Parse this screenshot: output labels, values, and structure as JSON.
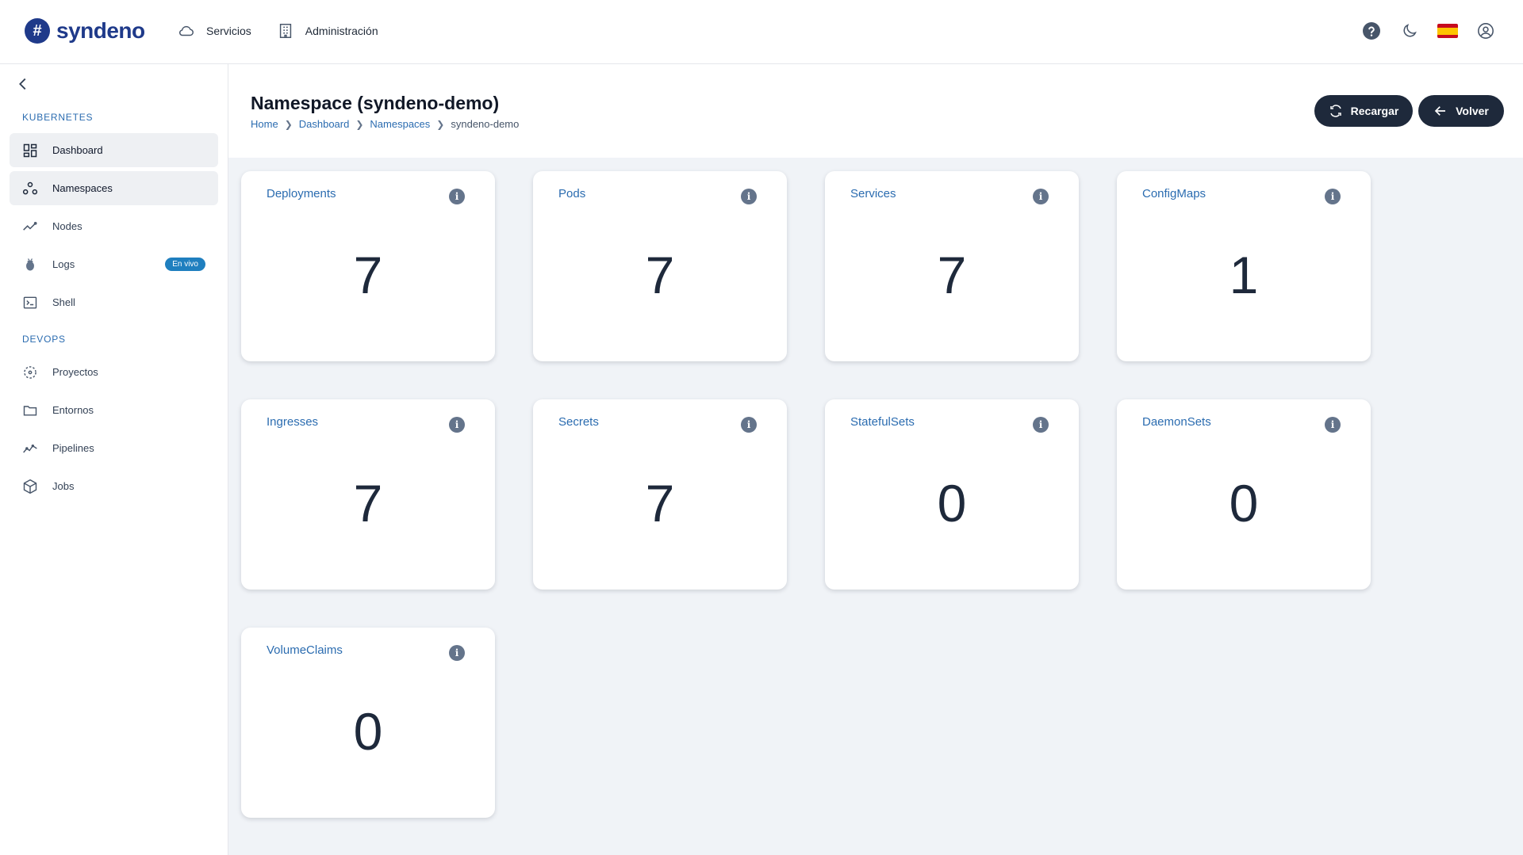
{
  "app": {
    "logo_text": "syndeno",
    "logo_glyph": "#"
  },
  "topnav": {
    "items": [
      {
        "label": "Servicios",
        "icon": "cloud-icon"
      },
      {
        "label": "Administración",
        "icon": "building-icon"
      }
    ]
  },
  "top_actions": {
    "help_icon": "help-circle-icon",
    "theme_icon": "moon-icon",
    "language": "es",
    "account_icon": "user-circle-icon"
  },
  "sidebar": {
    "sections": [
      {
        "title": "KUBERNETES"
      },
      {
        "title": "DEVOPS"
      }
    ],
    "items": [
      {
        "label": "Dashboard",
        "icon": "dashboard-icon"
      },
      {
        "label": "Namespaces",
        "icon": "namespaces-icon"
      },
      {
        "label": "Nodes",
        "icon": "nodes-icon"
      },
      {
        "label": "Logs",
        "icon": "bug-icon",
        "badge": "En vivo"
      },
      {
        "label": "Shell",
        "icon": "terminal-icon"
      },
      {
        "label": "Proyectos",
        "icon": "projects-icon"
      },
      {
        "label": "Entornos",
        "icon": "folder-icon"
      },
      {
        "label": "Pipelines",
        "icon": "pipelines-icon"
      },
      {
        "label": "Jobs",
        "icon": "cube-icon"
      }
    ]
  },
  "page": {
    "title": "Namespace (syndeno-demo)",
    "breadcrumb": [
      "Home",
      "Dashboard",
      "Namespaces",
      "syndeno-demo"
    ],
    "reload_label": "Recargar",
    "back_label": "Volver"
  },
  "cards": [
    {
      "title": "Deployments",
      "value": "7"
    },
    {
      "title": "Pods",
      "value": "7"
    },
    {
      "title": "Services",
      "value": "7"
    },
    {
      "title": "ConfigMaps",
      "value": "1"
    },
    {
      "title": "Ingresses",
      "value": "7"
    },
    {
      "title": "Secrets",
      "value": "7"
    },
    {
      "title": "StatefulSets",
      "value": "0"
    },
    {
      "title": "DaemonSets",
      "value": "0"
    },
    {
      "title": "VolumeClaims",
      "value": "0"
    }
  ],
  "colors": {
    "accent": "#2b6cb0",
    "dark_button": "#1e293b",
    "badge": "#1f7fbf",
    "background": "#f0f3f7"
  }
}
